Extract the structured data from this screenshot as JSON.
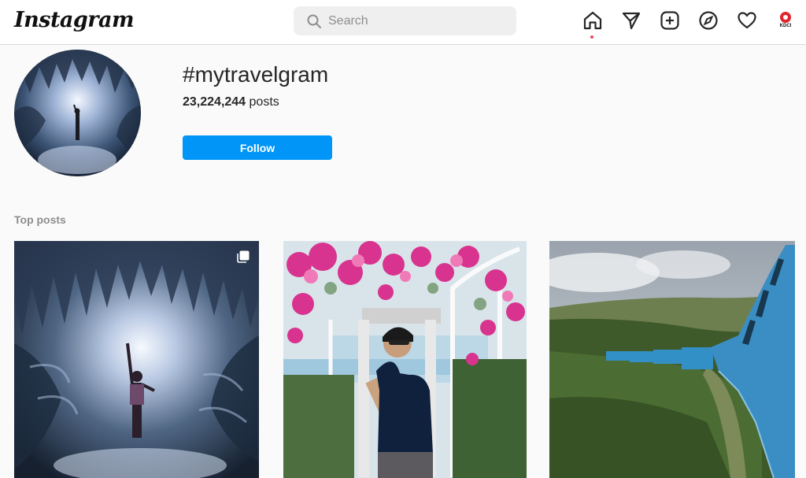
{
  "header": {
    "logo": "Instagram",
    "search": {
      "placeholder": "Search"
    },
    "nav_icons": [
      "home-icon",
      "direct-message-icon",
      "new-post-icon",
      "explore-icon",
      "activity-heart-icon"
    ],
    "profile_avatar_text": "KDCI"
  },
  "tag": {
    "title": "#mytravelgram",
    "post_count": "23,224,244",
    "post_suffix": " posts",
    "follow_label": "Follow"
  },
  "sections": {
    "top_posts_label": "Top posts"
  },
  "posts": [
    {
      "subject": "ice cave with person",
      "multi_photo": true
    },
    {
      "subject": "man under bougainvillea arch"
    },
    {
      "subject": "blue train through tea fields"
    }
  ],
  "colors": {
    "accent": "#0095f6",
    "notification": "#ed4956",
    "muted": "#8e8e8e"
  }
}
